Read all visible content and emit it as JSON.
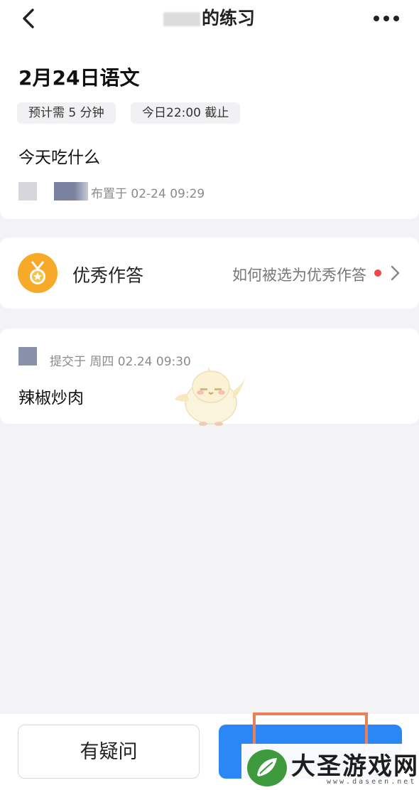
{
  "header": {
    "title": "的练习",
    "back_icon": "chevron-left-icon",
    "more_icon": "more-horizontal-icon"
  },
  "task": {
    "title": "2月24日语文",
    "tags": {
      "duration": "预计需 5 分钟",
      "deadline": "今日22:00 截止"
    },
    "content": "今天吃什么",
    "assign_time": "布置于 02-24 09:29"
  },
  "excellent": {
    "label": "优秀作答",
    "link": "如何被选为优秀作答",
    "medal_icon": "medal-icon",
    "chevron_icon": "chevron-right-icon",
    "dot_color": "#f04848"
  },
  "answer": {
    "submit_time": "提交于 周四 02.24 09:30",
    "content": "辣椒炒肉"
  },
  "bottom_bar": {
    "question_label": "有疑问",
    "submit_color": "#2b87f5"
  },
  "watermark": {
    "text": "大圣游戏网",
    "url": "www.daseen.net"
  }
}
